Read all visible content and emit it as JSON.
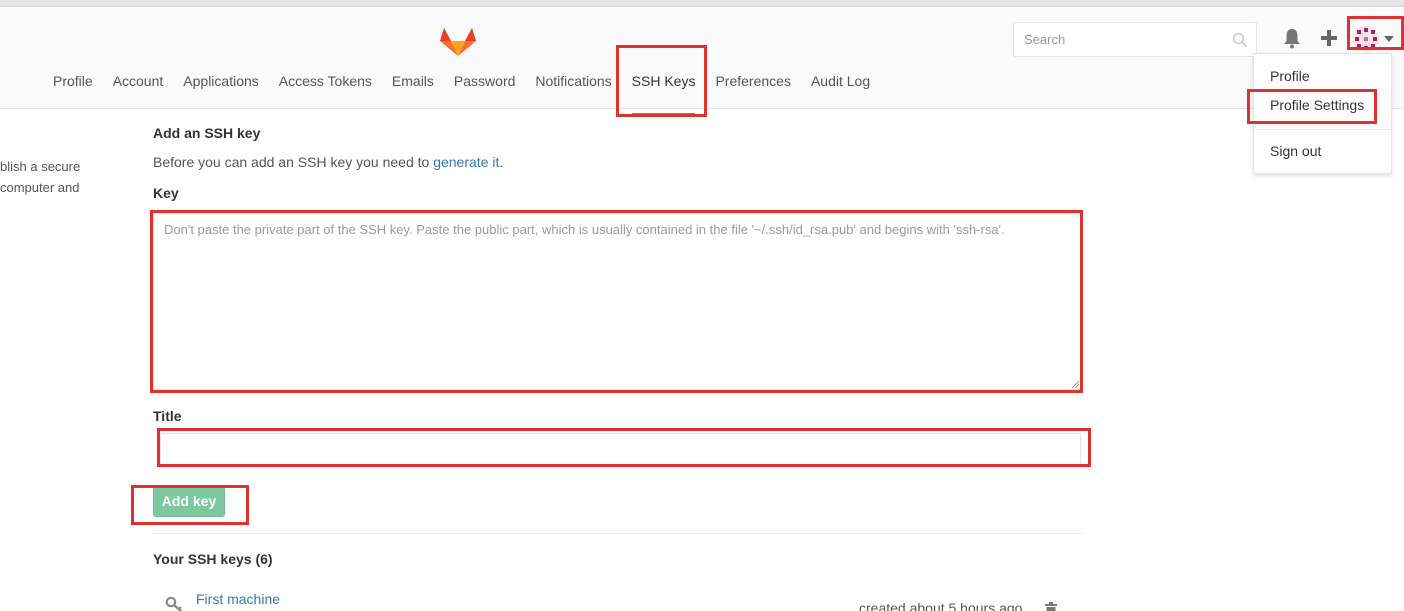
{
  "colors": {
    "accent": "#4a90e2",
    "link": "#3777b0",
    "success_button": "#7ec8a0",
    "highlight": "#e03131"
  },
  "header": {
    "search_placeholder": "Search",
    "icons": {
      "logo": "gitlab-tanuki-icon",
      "search": "search-icon",
      "notifications": "bell-icon",
      "new": "plus-icon",
      "avatar": "user-avatar",
      "menu": "caret-down-icon"
    }
  },
  "nav": {
    "items": [
      "Profile",
      "Account",
      "Applications",
      "Access Tokens",
      "Emails",
      "Password",
      "Notifications",
      "SSH Keys",
      "Preferences",
      "Audit Log"
    ],
    "active": "SSH Keys"
  },
  "user_menu": {
    "items": [
      "Profile",
      "Profile Settings",
      "Sign out"
    ]
  },
  "side_text": {
    "line1": "blish a secure",
    "line2": "computer and"
  },
  "form": {
    "heading": "Add an SSH key",
    "intro_text": "Before you can add an SSH key you need to ",
    "intro_link": "generate it",
    "intro_end": ".",
    "key_label": "Key",
    "key_placeholder": "Don't paste the private part of the SSH key. Paste the public part, which is usually contained in the file '~/.ssh/id_rsa.pub' and begins with 'ssh-rsa'.",
    "title_label": "Title",
    "title_value": "",
    "submit_label": "Add key"
  },
  "keys_list": {
    "heading": "Your SSH keys (6)",
    "items": [
      {
        "name": "First machine",
        "created": "created about 5 hours ago"
      }
    ]
  }
}
